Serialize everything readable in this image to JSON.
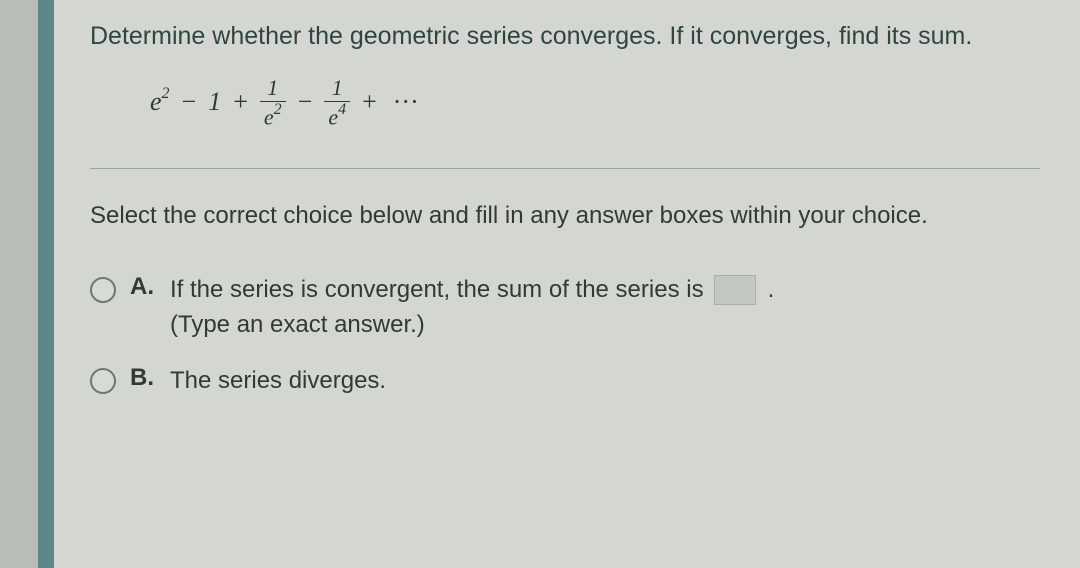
{
  "question": {
    "title": "Determine whether the geometric series converges. If it converges, find its sum.",
    "series": {
      "term1_base": "e",
      "term1_exp": "2",
      "op1": "−",
      "term2": "1",
      "op2": "+",
      "frac1_num": "1",
      "frac1_den_base": "e",
      "frac1_den_exp": "2",
      "op3": "−",
      "frac2_num": "1",
      "frac2_den_base": "e",
      "frac2_den_exp": "4",
      "op4": "+",
      "ellipsis": "···"
    }
  },
  "prompt": "Select the correct choice below and fill in any answer boxes within your choice.",
  "choices": {
    "a": {
      "label": "A.",
      "text_before_box": "If the series is convergent, the sum of the series is",
      "period": ".",
      "hint": "(Type an exact answer.)"
    },
    "b": {
      "label": "B.",
      "text": "The series diverges."
    }
  }
}
